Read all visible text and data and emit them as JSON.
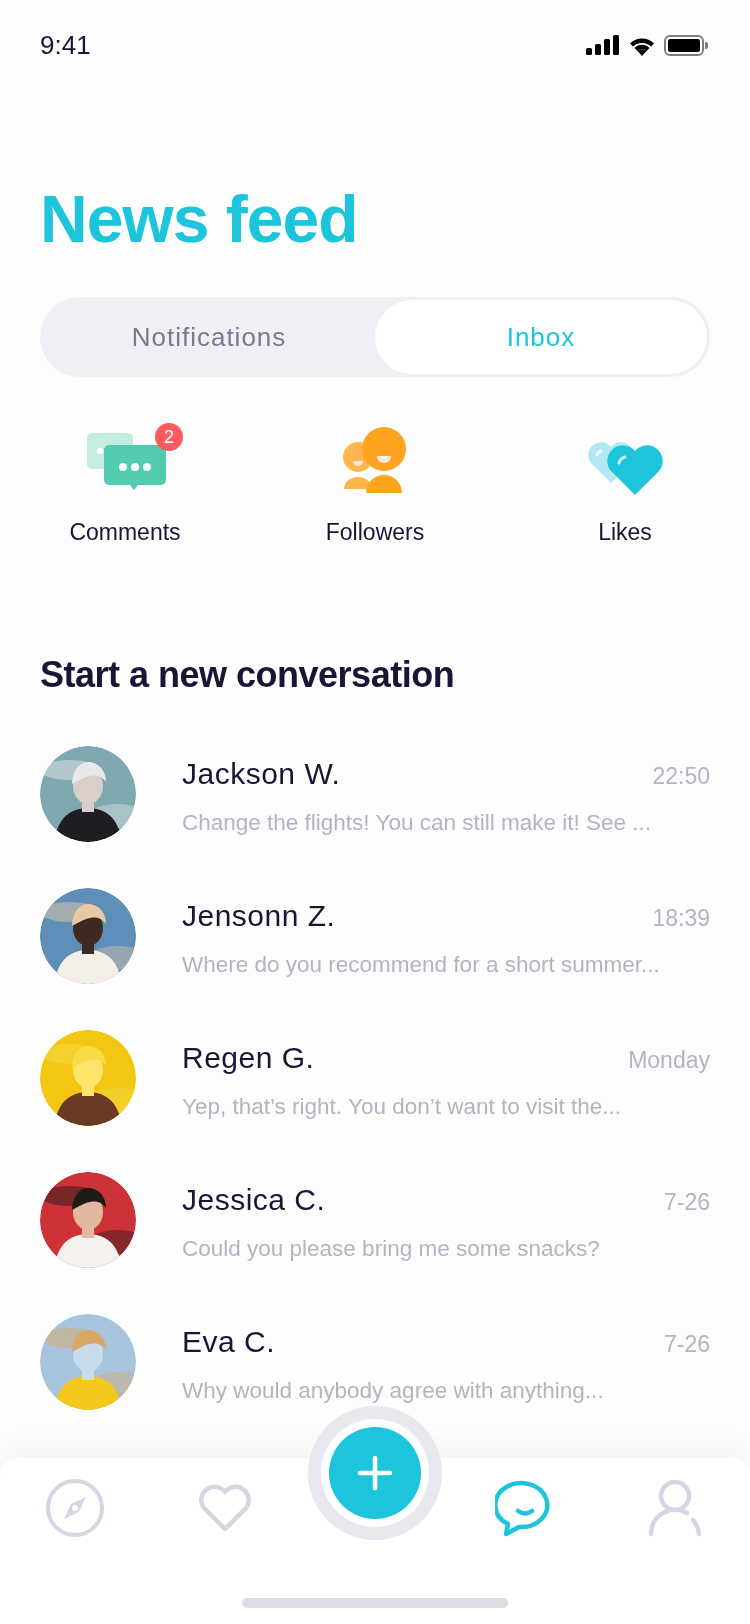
{
  "status_bar": {
    "time": "9:41"
  },
  "title": "News feed",
  "tabs": [
    {
      "label": "Notifications",
      "selected": false
    },
    {
      "label": "Inbox",
      "selected": true
    }
  ],
  "categories": [
    {
      "kind": "comments",
      "label": "Comments",
      "badge": "2"
    },
    {
      "kind": "followers",
      "label": "Followers"
    },
    {
      "kind": "likes",
      "label": "Likes"
    }
  ],
  "section_title": "Start a new conversation",
  "conversations": [
    {
      "name": "Jackson W.",
      "time": "22:50",
      "message": "Change the flights! You can still make it! See ..."
    },
    {
      "name": "Jensonn Z.",
      "time": "18:39",
      "message": "Where do you recommend for a short summer..."
    },
    {
      "name": "Regen G.",
      "time": "Monday",
      "message": "Yep, that’s right. You don’t want to visit the..."
    },
    {
      "name": "Jessica C.",
      "time": "7-26",
      "message": "Could you please bring me some snacks?"
    },
    {
      "name": "Eva C.",
      "time": "7-26",
      "message": "Why would anybody agree with anything..."
    }
  ],
  "tab_bar": {
    "items": [
      {
        "kind": "compass",
        "selected": false
      },
      {
        "kind": "heart",
        "selected": false
      },
      {
        "kind": "add",
        "selected": false
      },
      {
        "kind": "chat",
        "selected": true
      },
      {
        "kind": "person",
        "selected": false
      }
    ]
  }
}
